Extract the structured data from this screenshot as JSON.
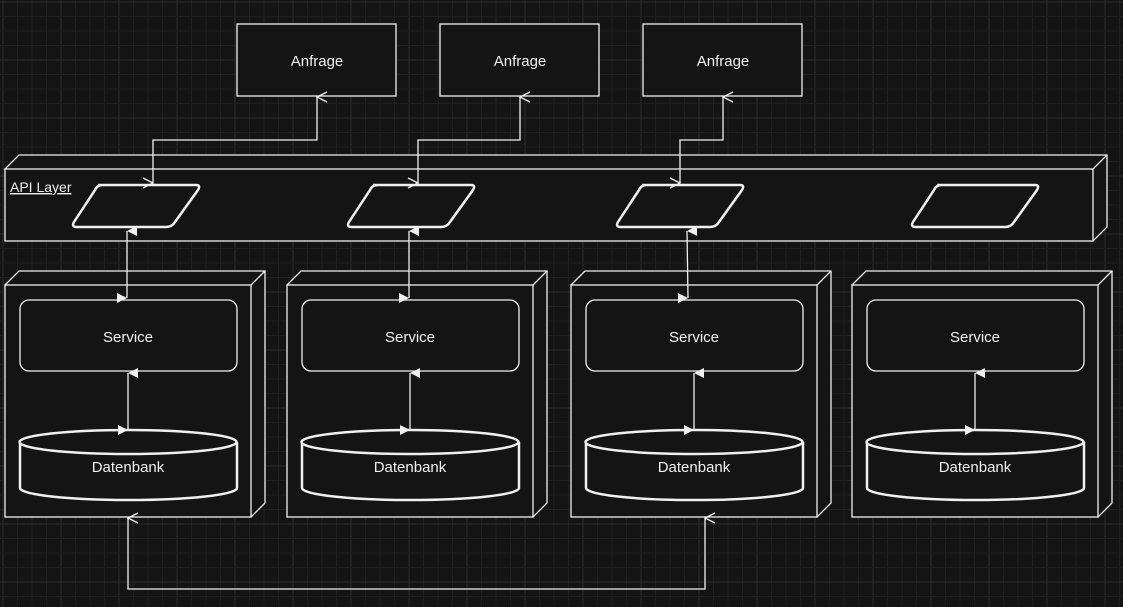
{
  "colors": {
    "background": "#141414",
    "grid_minor": "#222222",
    "grid_major": "#2c2c2c",
    "stroke": "#f0f0f0",
    "fill": "#141414"
  },
  "requests": [
    {
      "label": "Anfrage"
    },
    {
      "label": "Anfrage"
    },
    {
      "label": "Anfrage"
    }
  ],
  "api_layer": {
    "label": "API Layer",
    "endpoints": 4
  },
  "nodes": [
    {
      "service": "Service",
      "database": "Datenbank"
    },
    {
      "service": "Service",
      "database": "Datenbank"
    },
    {
      "service": "Service",
      "database": "Datenbank"
    },
    {
      "service": "Service",
      "database": "Datenbank"
    }
  ]
}
